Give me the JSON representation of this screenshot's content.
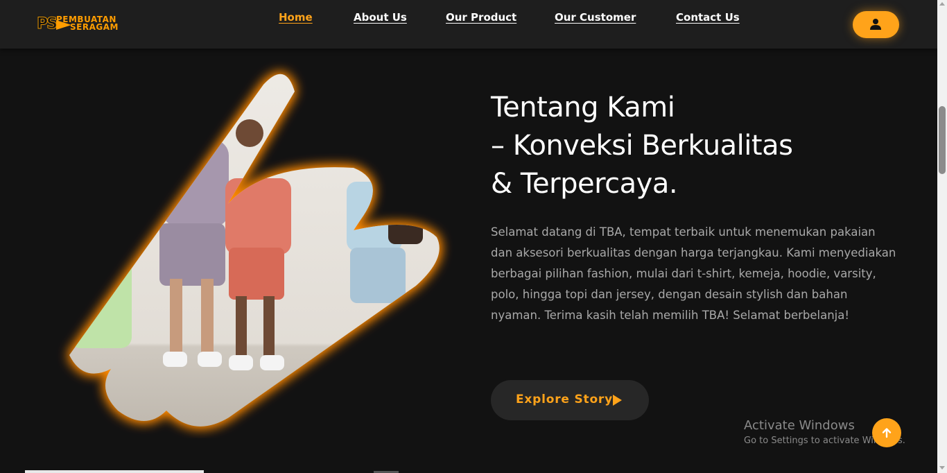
{
  "brand": {
    "logo_mark": "PS",
    "logo_line1": "PEMBUATAN",
    "logo_line2": "SERAGAM",
    "accent_color": "#ffa31a"
  },
  "nav": {
    "items": [
      {
        "label": "Home",
        "active": true
      },
      {
        "label": "About Us",
        "active": false
      },
      {
        "label": "Our Product",
        "active": false
      },
      {
        "label": "Our Customer",
        "active": false
      },
      {
        "label": "Contact Us",
        "active": false
      }
    ],
    "user_button_icon": "user-icon"
  },
  "hero": {
    "heading_lines": [
      "Tentang Kami",
      "– Konveksi Berkualitas",
      "& Terpercaya."
    ],
    "paragraph": "Selamat datang di TBA, tempat terbaik untuk menemukan pakaian dan aksesori berkualitas dengan harga terjangkau. Kami menyediakan berbagai pilihan fashion, mulai dari t-shirt, kemeja, hoodie, varsity, polo, hingga topi dan jersey, dengan desain stylish dan bahan nyaman. Terima kasih telah memilih TBA! Selamat berbelanja!",
    "button_label": "Explore Story",
    "button_icon": "play-arrow-icon"
  },
  "windows_watermark": {
    "title": "Activate Windows",
    "subtitle": "Go to Settings to activate Windows."
  },
  "back_to_top_icon": "arrow-up-icon"
}
